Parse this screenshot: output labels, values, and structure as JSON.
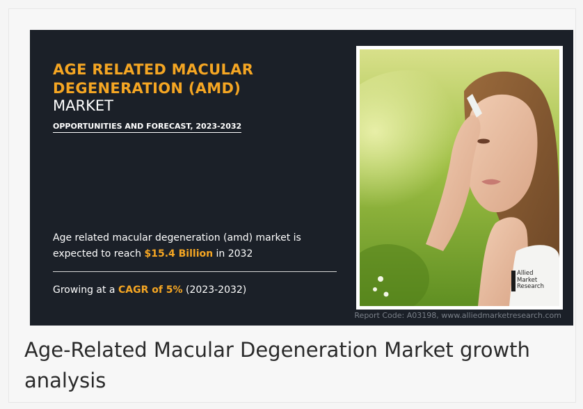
{
  "banner": {
    "title_line1": "AGE RELATED MACULAR",
    "title_line2": "DEGENERATION (AMD)",
    "title_line3": "MARKET",
    "subtitle": "OPPORTUNITIES AND FORECAST, 2023-2032",
    "desc_part1": "Age related macular degeneration (amd) market is expected to reach ",
    "desc_value": "$15.4 Billion",
    "desc_part2": " in 2032",
    "cagr_part1": "Growing at a ",
    "cagr_value": "CAGR of 5%",
    "cagr_part2": " (2023-2032)",
    "logo_line1": "Allied",
    "logo_line2": "Market",
    "logo_line3": "Research",
    "report_code": "Report Code: A03198, www.alliedmarketresearch.com"
  },
  "caption": "Age-Related Macular Degeneration Market growth analysis",
  "colors": {
    "accent": "#f5a623",
    "banner_bg": "#1b2028",
    "text_light": "#ffffff"
  }
}
